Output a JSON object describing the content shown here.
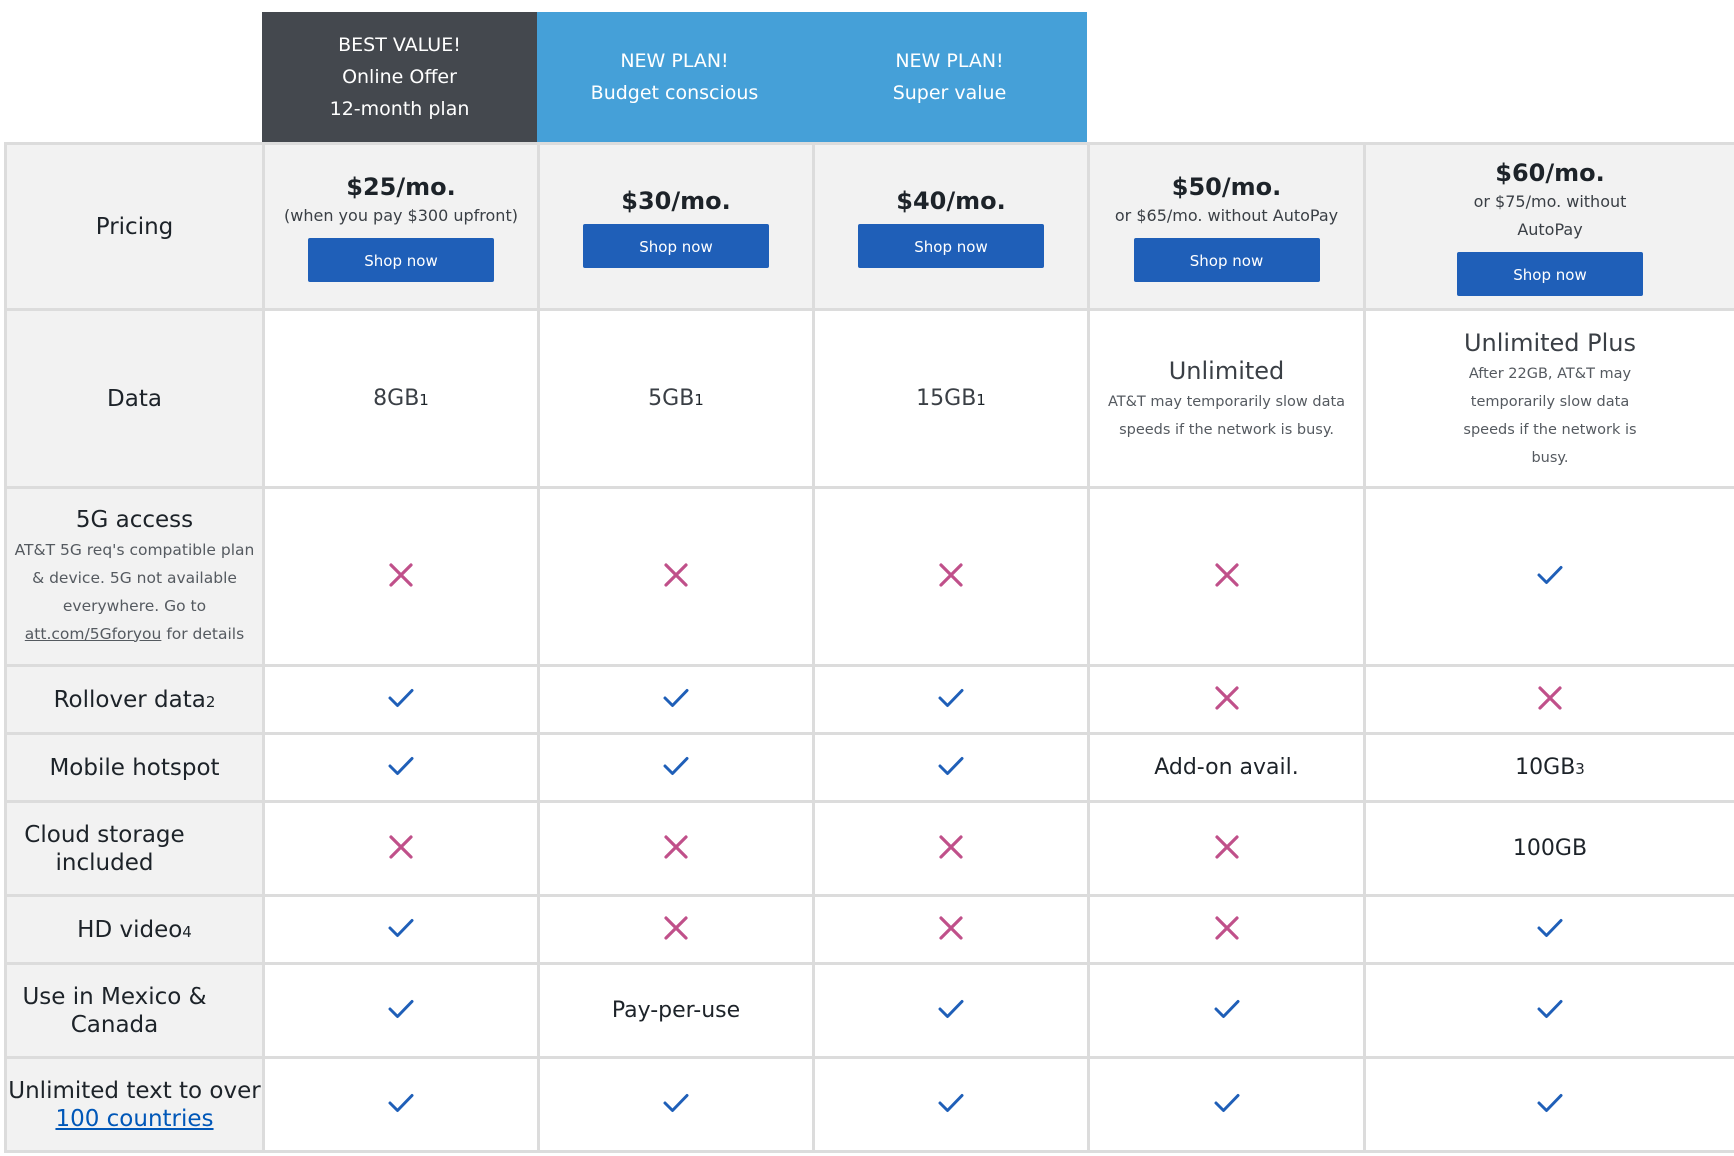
{
  "banners": [
    {
      "lines": [
        "BEST VALUE!",
        "Online Offer",
        "12-month plan"
      ],
      "color": "#44484e"
    },
    {
      "lines": [
        "NEW PLAN!",
        "Budget conscious"
      ],
      "color": "#45a0d8"
    },
    {
      "lines": [
        "NEW PLAN!",
        "Super value"
      ],
      "color": "#45a0d8"
    }
  ],
  "colors": {
    "check": "#1f5fb8",
    "x": "#c0508a",
    "button": "#1f5fb8"
  },
  "rows": {
    "pricing": {
      "label": "Pricing"
    },
    "data": {
      "label": "Data"
    },
    "fiveg": {
      "label": "5G access",
      "sub_text": "AT&T 5G req's compatible plan & device. 5G not available everywhere. Go to",
      "sub_link": "att.com/5Gforyou",
      "sub_suffix": "for details"
    },
    "rollover": {
      "label": "Rollover data",
      "footnote": "2"
    },
    "hotspot": {
      "label": "Mobile hotspot"
    },
    "cloud": {
      "label": "Cloud storage included"
    },
    "hd": {
      "label": "HD video",
      "footnote": "4"
    },
    "mexico": {
      "label": "Use in Mexico & Canada"
    },
    "text": {
      "label": "Unlimited text to over",
      "link": "100 countries"
    }
  },
  "plans": [
    {
      "price": "$25/mo.",
      "price_note": "(when you pay $300 upfront)",
      "shop_label": "Shop now",
      "data": "8GB",
      "data_fn": "1",
      "data_note": "",
      "fiveg": "x",
      "rollover": "check",
      "hotspot": "check",
      "cloud": "x",
      "hd": "check",
      "mexico": "check",
      "text": "check"
    },
    {
      "price": "$30/mo.",
      "price_note": "",
      "shop_label": "Shop now",
      "data": "5GB",
      "data_fn": "1",
      "data_note": "",
      "fiveg": "x",
      "rollover": "check",
      "hotspot": "check",
      "cloud": "x",
      "hd": "x",
      "mexico": "Pay-per-use",
      "text": "check"
    },
    {
      "price": "$40/mo.",
      "price_note": "",
      "shop_label": "Shop now",
      "data": "15GB",
      "data_fn": "1",
      "data_note": "",
      "fiveg": "x",
      "rollover": "check",
      "hotspot": "check",
      "cloud": "x",
      "hd": "x",
      "mexico": "check",
      "text": "check"
    },
    {
      "price": "$50/mo.",
      "price_note": "or $65/mo. without AutoPay",
      "shop_label": "Shop now",
      "data": "Unlimited",
      "data_fn": "",
      "data_note": "AT&T may temporarily slow data speeds if the network is busy.",
      "fiveg": "x",
      "rollover": "x",
      "hotspot": "Add-on avail.",
      "cloud": "x",
      "hd": "x",
      "mexico": "check",
      "text": "check"
    },
    {
      "price": "$60/mo.",
      "price_note": "or $75/mo. without AutoPay",
      "shop_label": "Shop now",
      "data": "Unlimited Plus",
      "data_fn": "",
      "data_note": "After 22GB, AT&T may temporarily slow data speeds if the network is busy.",
      "fiveg": "check",
      "rollover": "x",
      "hotspot": "10GB",
      "hotspot_fn": "3",
      "cloud": "100GB",
      "hd": "check",
      "mexico": "check",
      "text": "check"
    }
  ]
}
